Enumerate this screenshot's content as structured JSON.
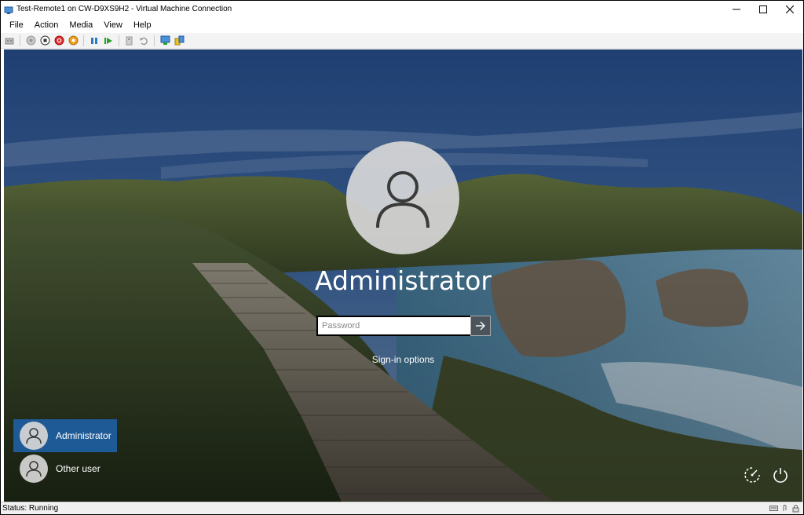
{
  "window": {
    "title": "Test-Remote1 on CW-D9XS9H2 - Virtual Machine Connection"
  },
  "menu": {
    "items": [
      {
        "label": "File"
      },
      {
        "label": "Action"
      },
      {
        "label": "Media"
      },
      {
        "label": "View"
      },
      {
        "label": "Help"
      }
    ]
  },
  "toolbar": {
    "icons": [
      "ctrl-alt-del-icon",
      "start-icon",
      "turn-off-icon",
      "shut-down-icon",
      "save-icon",
      "pause-icon",
      "resume-icon",
      "checkpoint-icon",
      "revert-icon",
      "enhanced-session-icon",
      "share-icon"
    ]
  },
  "login": {
    "username": "Administrator",
    "password_placeholder": "Password",
    "sign_in_options": "Sign-in options"
  },
  "users": [
    {
      "label": "Administrator",
      "selected": true
    },
    {
      "label": "Other user",
      "selected": false
    }
  ],
  "status": {
    "text": "Status: Running"
  },
  "colors": {
    "selected_user": "#1e5a96"
  }
}
